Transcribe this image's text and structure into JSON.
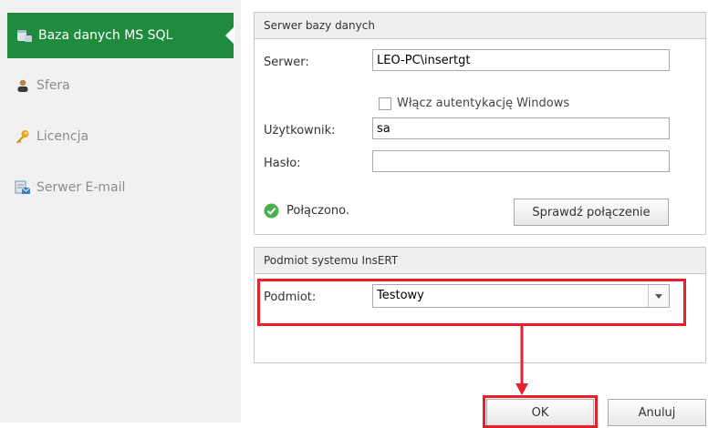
{
  "sidebar": {
    "items": [
      {
        "label": "Baza danych MS SQL",
        "icon": "database-icon"
      },
      {
        "label": "Sfera",
        "icon": "user-icon"
      },
      {
        "label": "Licencja",
        "icon": "key-icon"
      },
      {
        "label": "Serwer E-mail",
        "icon": "email-server-icon"
      }
    ]
  },
  "db_group": {
    "title": "Serwer bazy danych",
    "server_label": "Serwer:",
    "server_value": "LEO-PC\\insertgt",
    "windows_auth_label": "Włącz autentykację Windows",
    "user_label": "Użytkownik:",
    "user_value": "sa",
    "password_label": "Hasło:",
    "password_value": "",
    "status_text": "Połączono.",
    "check_button": "Sprawdź połączenie"
  },
  "subject_group": {
    "title": "Podmiot systemu InsERT",
    "subject_label": "Podmiot:",
    "subject_value": "Testowy"
  },
  "footer": {
    "ok_label": "OK",
    "cancel_label": "Anuluj"
  },
  "colors": {
    "accent": "#1f8b3c",
    "highlight": "#e8202a",
    "status_ok": "#4caf50"
  }
}
